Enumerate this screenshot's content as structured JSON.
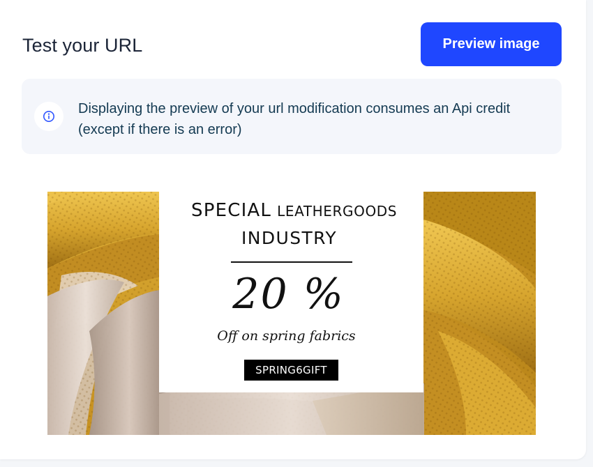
{
  "section": {
    "title": "Test your URL",
    "preview_button_label": "Preview image"
  },
  "info": {
    "icon": "info-circle-icon",
    "message": "Displaying the preview of your url modification consumes an Api credit (except if there is an error)"
  },
  "preview": {
    "headline_word1": "SPECIAL",
    "headline_word2": "LEATHERGOODS",
    "headline_line2": "INDUSTRY",
    "discount": "20 %",
    "subtitle": "Off on spring fabrics",
    "promo_code": "SPRING6GIFT"
  },
  "colors": {
    "accent": "#1f47ff",
    "info_background": "#f4f6fb",
    "info_text": "#143a52",
    "title_text": "#1b2437",
    "fabric_gold": "#d4a52e",
    "fabric_cream": "#d9c9bd"
  }
}
